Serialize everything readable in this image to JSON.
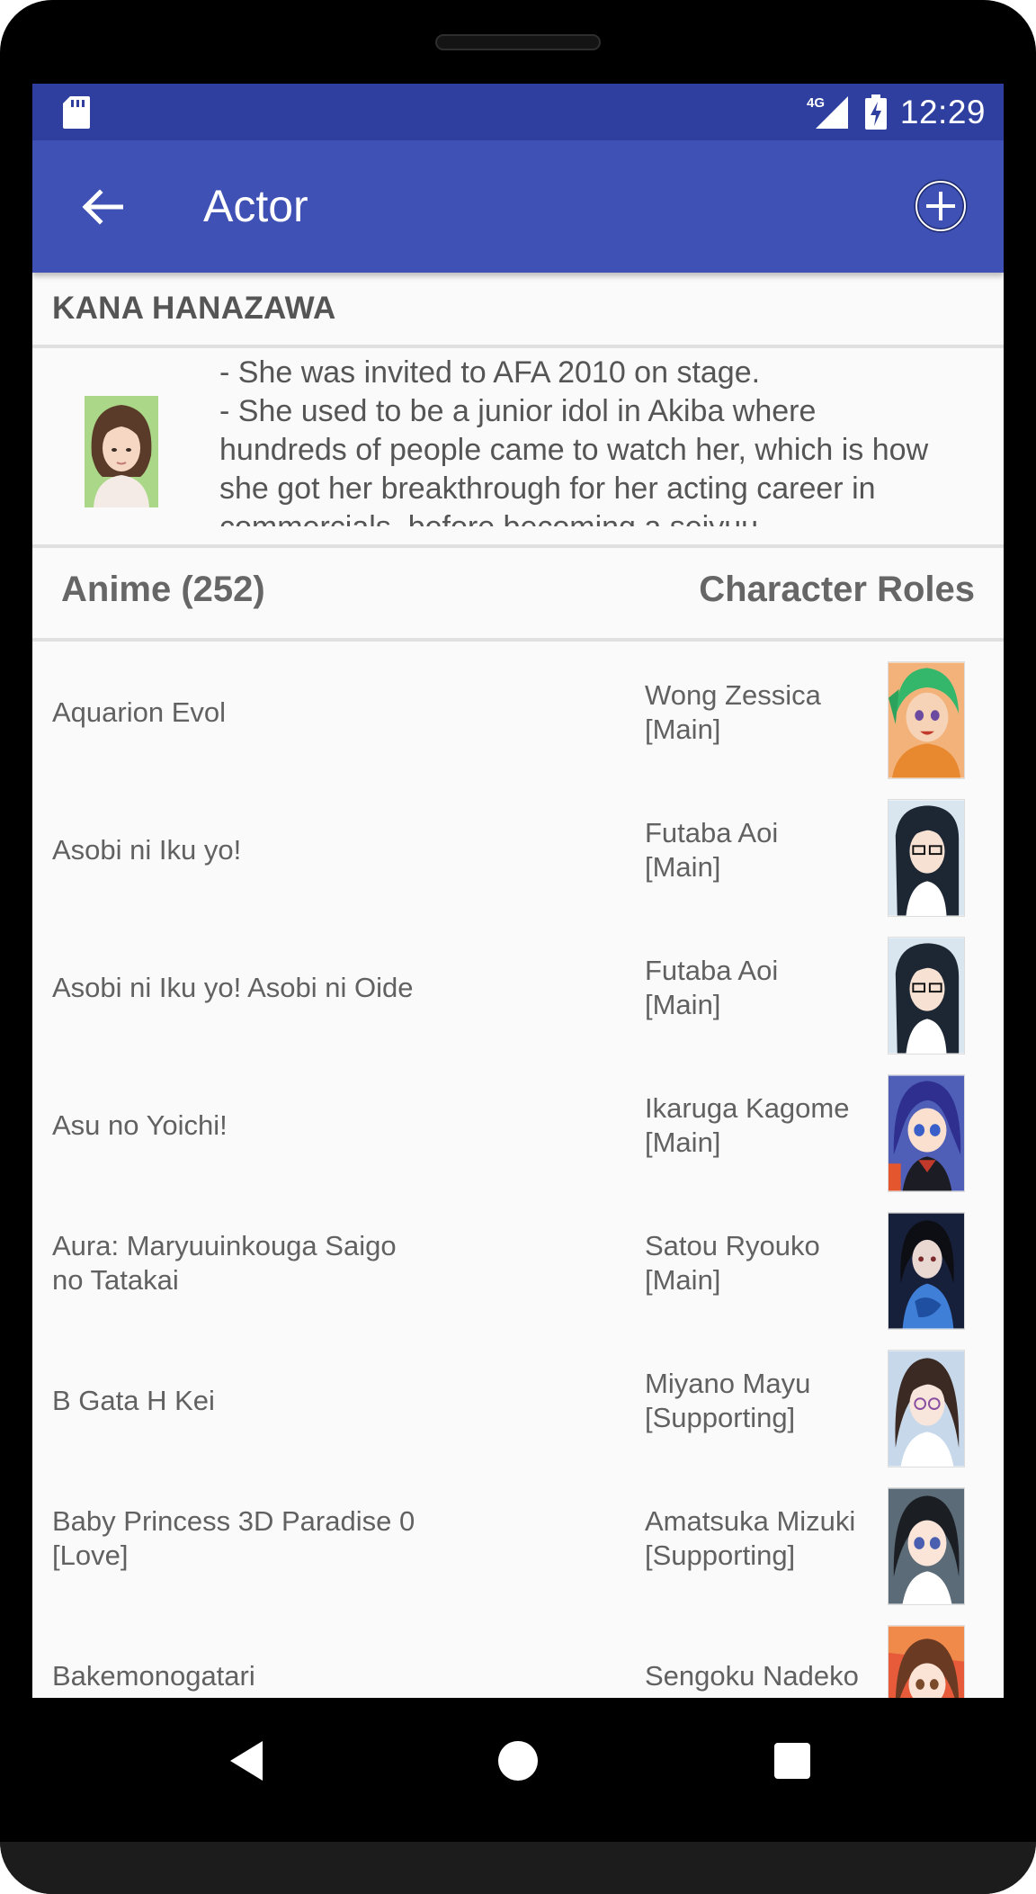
{
  "status_bar": {
    "network": "4G",
    "time": "12:29"
  },
  "app_bar": {
    "title": "Actor"
  },
  "actor": {
    "name": "KANA HANAZAWA",
    "bio_lines": [
      "- She was invited to AFA 2010 on stage.",
      "- She used to be a junior idol in Akiba where",
      "hundreds of people came to watch her, which is how",
      "she got her breakthrough for her acting career in",
      "commercials, before becoming a seiyuu."
    ]
  },
  "section": {
    "left_label": "Anime (252)",
    "right_label": "Character Roles"
  },
  "roles": [
    {
      "anime": "Aquarion Evol",
      "character": "Wong Zessica [Main]"
    },
    {
      "anime": "Asobi ni Iku yo!",
      "character": "Futaba Aoi [Main]"
    },
    {
      "anime": "Asobi ni Iku yo! Asobi ni Oide",
      "character": "Futaba Aoi [Main]"
    },
    {
      "anime": "Asu no Yoichi!",
      "character": "Ikaruga Kagome [Main]"
    },
    {
      "anime": "Aura: Maryuuinkouga Saigo no Tatakai",
      "character": "Satou Ryouko [Main]"
    },
    {
      "anime": "B Gata H Kei",
      "character": "Miyano Mayu [Supporting]"
    },
    {
      "anime": "Baby Princess 3D Paradise 0 [Love]",
      "character": "Amatsuka Mizuki [Supporting]"
    },
    {
      "anime": "Bakemonogatari",
      "character": "Sengoku Nadeko"
    }
  ],
  "icons": {
    "back": "arrow-left-icon",
    "add": "plus-circle-icon",
    "sd": "sd-card-icon",
    "signal": "signal-icon",
    "battery": "battery-charging-icon"
  },
  "colors": {
    "status_bar": "#2f3fa0",
    "app_bar": "#3f51b5",
    "background": "#fafafa",
    "text": "#616161"
  }
}
